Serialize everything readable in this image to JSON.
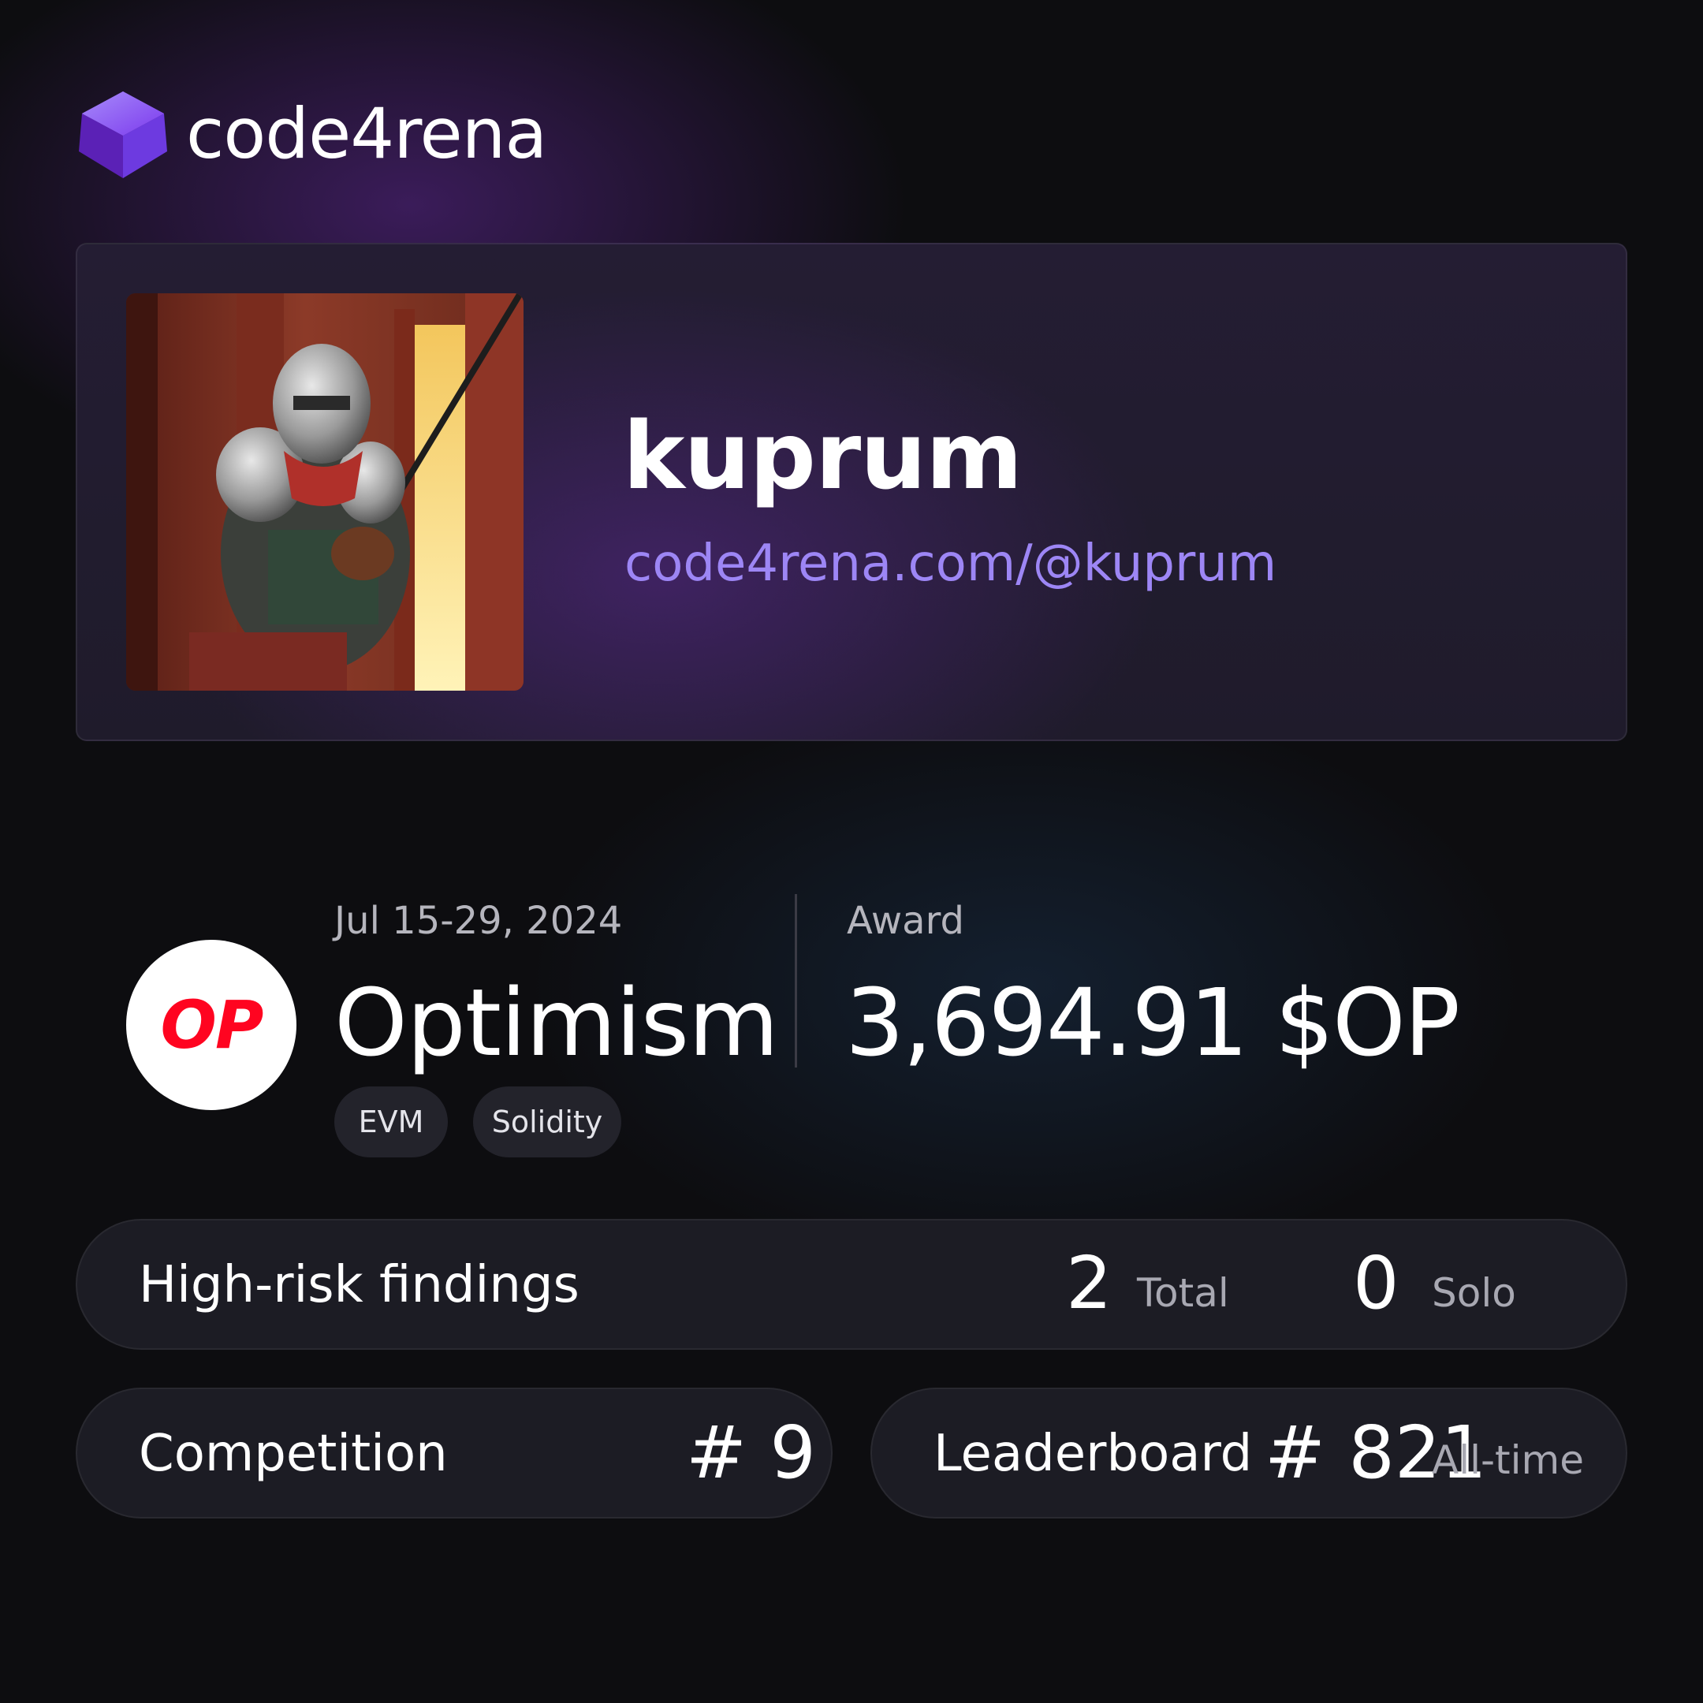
{
  "brand": {
    "name": "code4rena",
    "icon": "cube-logo-icon"
  },
  "profile": {
    "username": "kuprum",
    "url": "code4rena.com/@kuprum",
    "avatar": "armored-knight-avatar"
  },
  "contest": {
    "badge_text": "OP",
    "date": "Jul 15-29, 2024",
    "name": "Optimism",
    "tags": [
      "EVM",
      "Solidity"
    ],
    "award_label": "Award",
    "award_value": "3,694.91 $OP"
  },
  "stats": {
    "high_risk": {
      "label": "High-risk findings",
      "total": "2",
      "total_label": "Total",
      "solo": "0",
      "solo_label": "Solo"
    },
    "competition": {
      "label": "Competition",
      "rank": "# 9"
    },
    "leaderboard": {
      "label": "Leaderboard",
      "rank": "# 821",
      "period": "All-time"
    }
  },
  "colors": {
    "accent": "#9d86f5",
    "op_red": "#ff0420",
    "background": "#0d0d10"
  }
}
